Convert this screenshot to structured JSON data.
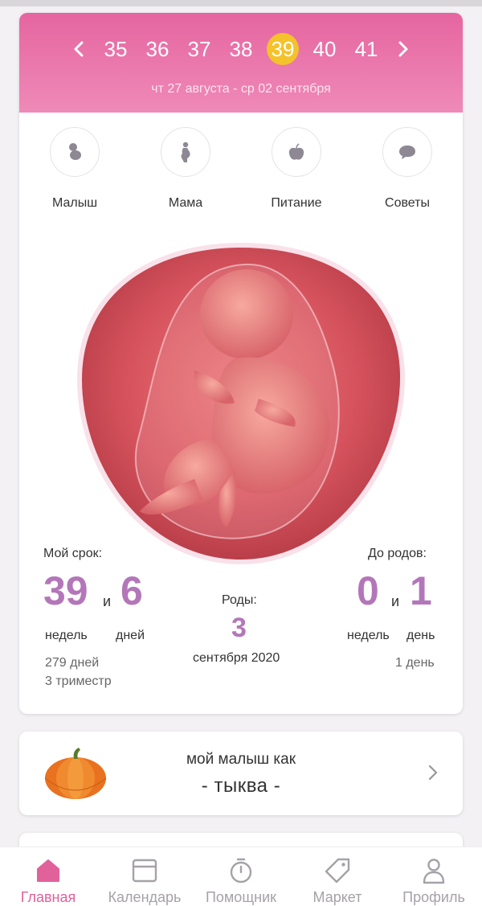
{
  "weeks": {
    "items": [
      "35",
      "36",
      "37",
      "38",
      "39",
      "40",
      "41"
    ],
    "active": "39",
    "date_range": "чт 27 августа - ср 02 сентября"
  },
  "categories": [
    {
      "label": "Малыш",
      "icon": "baby-icon"
    },
    {
      "label": "Мама",
      "icon": "mother-icon"
    },
    {
      "label": "Питание",
      "icon": "apple-icon"
    },
    {
      "label": "Советы",
      "icon": "chat-bubble-icon"
    }
  ],
  "stats": {
    "my_term_label": "Мой срок:",
    "weeks_value": "39",
    "and": "и",
    "days_value": "6",
    "weeks_unit": "недель",
    "days_unit": "дней",
    "total_days": "279 дней",
    "trimester": "3 триместр",
    "birth_label": "Роды:",
    "birth_day": "3",
    "birth_month_year": "сентября 2020",
    "until_label": "До родов:",
    "until_weeks": "0",
    "until_and": "и",
    "until_days": "1",
    "until_weeks_unit": "недель",
    "until_days_unit": "день",
    "until_total": "1 день"
  },
  "size_card": {
    "line1": "мой малыш как",
    "line2": "- тыква -",
    "icon": "pumpkin-icon"
  },
  "tabs": [
    {
      "label": "Главная",
      "icon": "home-icon",
      "active": true
    },
    {
      "label": "Календарь",
      "icon": "calendar-icon",
      "active": false
    },
    {
      "label": "Помощник",
      "icon": "stopwatch-icon",
      "active": false
    },
    {
      "label": "Маркет",
      "icon": "tag-icon",
      "active": false
    },
    {
      "label": "Профиль",
      "icon": "person-icon",
      "active": false
    }
  ],
  "colors": {
    "accent_pink": "#e1619b",
    "number_purple": "#b377b9",
    "active_week": "#f4c22b"
  }
}
